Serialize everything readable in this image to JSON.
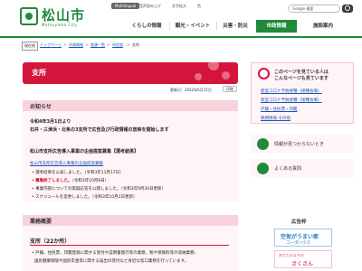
{
  "header": {
    "logo_text": "松山市",
    "logo_sub": "Matsuyama City",
    "util": {
      "language_badge": "Multilingual",
      "voice": "音声読み上げ",
      "text_size": "文字拡大",
      "color": "色",
      "search_placeholder": "Google 検索"
    },
    "nav": [
      {
        "label": "くらしの情報"
      },
      {
        "label": "観光・イベント"
      },
      {
        "label": "災害・防災"
      },
      {
        "label": "市政情報"
      },
      {
        "label": "施設案内"
      }
    ]
  },
  "breadcrumb": {
    "tag": "現在地",
    "items": [
      "トップページ",
      "市政情報",
      "各課一覧",
      "市民部",
      "支所"
    ]
  },
  "page": {
    "title": "支所",
    "updated": "更新日：2022年6月15日",
    "print": "印刷"
  },
  "notice": {
    "heading": "お知らせ",
    "lines": {
      "date1": "令和4年3月1日より",
      "text1": "石井・三津浜・北条の3支所で広告及び行政情報の放映を開始します",
      "topic": "松山市支所広告導入事業の企画提案募集【選考結果】",
      "link": "松山市支所広告導入事業の企画提案募集",
      "b1": "選考結果を公表しました。（令和3年11月17日）",
      "b2_red": "募集終了しました。",
      "b2_rest": "（令和3年10月8日）",
      "b3": "事業内容についての質疑応答を公開しました。（令和3年9月30日更新）",
      "b4": "スケジュールを変更しました。（令和3年10月1日更新）"
    }
  },
  "business": {
    "heading": "業務概要",
    "sub": "支所（22か所）",
    "line1": "戸籍、住民票、印鑑登録に関する受付や証明書発行等の業務、税や保険料等の収納業務、",
    "line2": "国民健康保険や国民年金等に関する届出の受付など身近な窓口業務を行っています。"
  },
  "sidebar": {
    "popular_title_1": "このページを見ている人は",
    "popular_title_2": "こんなページも見ています",
    "links": [
      "新型コロナ予防接種（接種会場）",
      "新型コロナ予防接種（接種会場）",
      "戸籍・住民票・印鑑",
      "税務情報 その他"
    ],
    "row1": "情報が見つからないとき",
    "row2": "よくある質問",
    "ad_title": "広告枠",
    "ad1_a": "空気がうまい家",
    "ad1_b": "コーポハウス",
    "ad2_a": "あなたのまちの",
    "ad2_b": "さくさん"
  },
  "colors": {
    "brand_green": "#1e8a3a",
    "accent_red": "#d4143a",
    "pink_light": "#fff5f7",
    "pink_head": "#f8d3dc"
  }
}
